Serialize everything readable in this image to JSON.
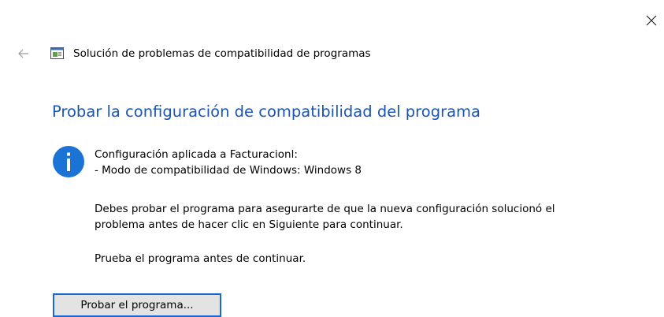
{
  "window": {
    "title": "Solución de problemas de compatibilidad de programas"
  },
  "icons": {
    "close": "close-icon",
    "back": "back-arrow-icon",
    "app": "troubleshooter-app-icon",
    "info": "info-icon"
  },
  "colors": {
    "heading": "#1a55b5",
    "info_icon": "#1b73d6",
    "button_border": "#1a66d4",
    "button_bg": "#e3e3e3"
  },
  "main": {
    "heading": "Probar la configuración de compatibilidad del programa",
    "settings_applied": "Configuración aplicada a Facturacionl:",
    "compat_mode": "- Modo de compatibilidad de Windows: Windows 8",
    "instruction_line1": "Debes probar el programa para asegurarte de que la nueva configuración solucionó el",
    "instruction_line2": "problema antes de hacer clic en Siguiente para continuar.",
    "prompt": "Prueba el programa antes de continuar.",
    "test_button_label": "Probar el programa..."
  }
}
